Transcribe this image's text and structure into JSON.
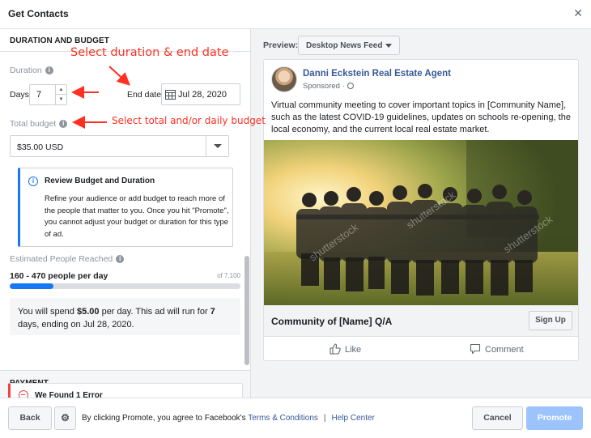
{
  "header": {
    "title": "Get Contacts",
    "close_icon": "close-icon"
  },
  "left": {
    "section_duration_title": "DURATION AND BUDGET",
    "duration_label": "Duration",
    "days_label": "Days",
    "days_value": "7",
    "end_date_label": "End date",
    "end_date_value": "Jul 28, 2020",
    "total_budget_label": "Total budget",
    "budget_value": "$35.00 USD",
    "review": {
      "title": "Review Budget and Duration",
      "body": "Refine your audience or add budget to reach more of the people that matter to you. Once you hit \"Promote\", you cannot adjust your budget or duration for this type of ad."
    },
    "estimated_label": "Estimated People Reached",
    "reach_range": "160 - 470 people per day",
    "reach_of": "of 7,100",
    "reach_fraction": 0.19,
    "spend": {
      "p1": "You will spend ",
      "amount": "$5.00",
      "p2": " per day. This ad will run for ",
      "days": "7",
      "p3": " days, ending on Jul 28, 2020."
    },
    "payment_title": "PAYMENT",
    "error_title": "We Found 1 Error"
  },
  "annotations": {
    "note1": "Select duration & end date",
    "note2": "Select total and/or daily budget"
  },
  "preview": {
    "label": "Preview:",
    "placement": "Desktop News Feed",
    "page_name": "Danni Eckstein Real Estate Agent",
    "sponsored": "Sponsored ·",
    "post_text": "Virtual community meeting to cover important topics in [Community Name], such as the latest COVID-19 guidelines, updates on schools re-opening, the local economy, and the current local real estate market.",
    "image_watermark": "shutterstock",
    "cta_title": "Community of [Name] Q/A",
    "cta_button": "Sign Up",
    "like_label": "Like",
    "comment_label": "Comment"
  },
  "footer": {
    "back": "Back",
    "terms_prefix": "By clicking Promote, you agree to Facebook's",
    "terms_link": "Terms & Conditions",
    "separator": "|",
    "help_link": "Help Center",
    "cancel": "Cancel",
    "promote": "Promote"
  },
  "colors": {
    "accent": "#1877f2",
    "error": "#fa3e3e",
    "annotation": "#ff2f21",
    "link": "#385898"
  }
}
